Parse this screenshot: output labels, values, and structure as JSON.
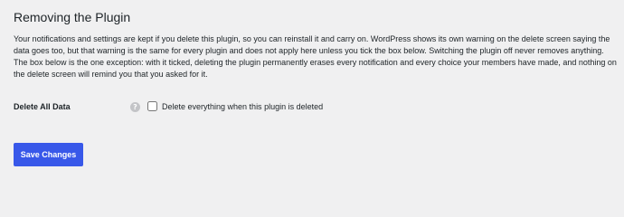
{
  "section": {
    "title": "Removing the Plugin",
    "description": "Your notifications and settings are kept if you delete this plugin, so you can reinstall it and carry on. WordPress shows its own warning on the delete screen saying the data goes too, but that warning is the same for every plugin and does not apply here unless you tick the box below. Switching the plugin off never removes anything. The box below is the one exception: with it ticked, deleting the plugin permanently erases every notification and every choice your members have made, and nothing on the delete screen will remind you that you asked for it."
  },
  "delete_all_data": {
    "label": "Delete All Data",
    "help_icon": "question-mark-icon",
    "help_glyph": "?",
    "checkbox_label": "Delete everything when this plugin is deleted",
    "checked": false
  },
  "actions": {
    "save_label": "Save Changes"
  },
  "colors": {
    "background": "#f0f0f1",
    "accent": "#3858e9",
    "text": "#1d2327",
    "help_icon": "#c3c4c7"
  }
}
